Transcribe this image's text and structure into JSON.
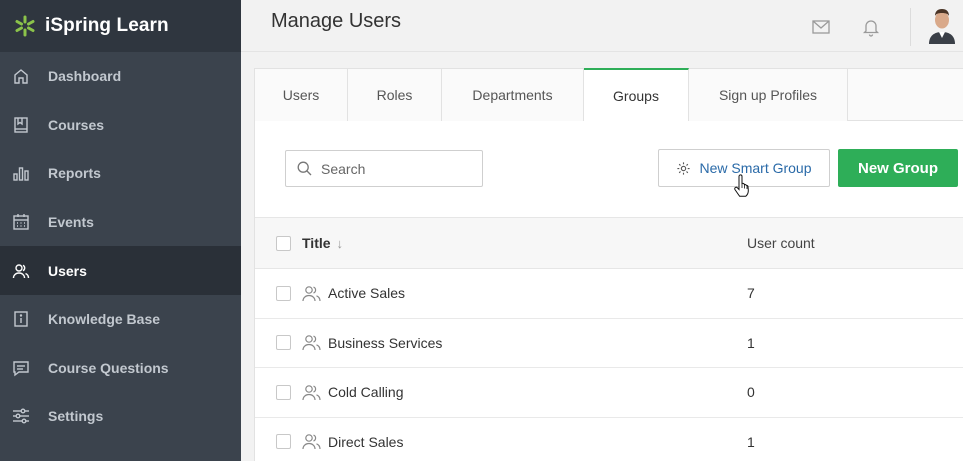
{
  "brand": {
    "name": "iSpring Learn",
    "logo_color": "#8bc34a"
  },
  "sidebar": {
    "items": [
      {
        "label": "Dashboard",
        "icon": "home-icon",
        "active": false
      },
      {
        "label": "Courses",
        "icon": "book-icon",
        "active": false
      },
      {
        "label": "Reports",
        "icon": "bar-chart-icon",
        "active": false
      },
      {
        "label": "Events",
        "icon": "calendar-icon",
        "active": false
      },
      {
        "label": "Users",
        "icon": "users-icon",
        "active": true
      },
      {
        "label": "Knowledge Base",
        "icon": "info-book-icon",
        "active": false
      },
      {
        "label": "Course Questions",
        "icon": "chat-icon",
        "active": false
      },
      {
        "label": "Settings",
        "icon": "sliders-icon",
        "active": false
      }
    ]
  },
  "header": {
    "title": "Manage Users"
  },
  "tabs": [
    {
      "label": "Users",
      "active": false
    },
    {
      "label": "Roles",
      "active": false
    },
    {
      "label": "Departments",
      "active": false
    },
    {
      "label": "Groups",
      "active": true
    },
    {
      "label": "Sign up Profiles",
      "active": false
    }
  ],
  "toolbar": {
    "search_placeholder": "Search",
    "smart_group_label": "New Smart Group",
    "new_group_label": "New Group"
  },
  "table": {
    "columns": {
      "title": "Title",
      "sort_indicator": "↓",
      "count": "User count"
    },
    "rows": [
      {
        "title": "Active Sales",
        "count": "7"
      },
      {
        "title": "Business Services",
        "count": "1"
      },
      {
        "title": "Cold Calling",
        "count": "0"
      },
      {
        "title": "Direct Sales",
        "count": "1"
      }
    ]
  },
  "colors": {
    "accent": "#2eae58",
    "link": "#2a6aa8",
    "sidebar": "#3b434d"
  }
}
